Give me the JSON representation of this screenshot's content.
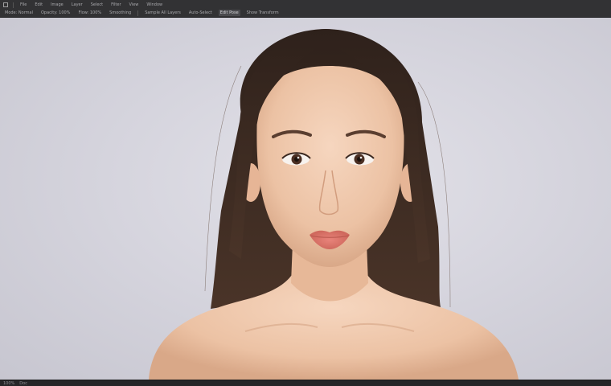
{
  "toolbar": {
    "row1": [
      {
        "icon": "app-menu-icon"
      },
      {
        "label": "File"
      },
      {
        "label": "Edit"
      },
      {
        "label": "Image"
      },
      {
        "label": "Layer"
      },
      {
        "label": "Select"
      },
      {
        "label": "Filter"
      },
      {
        "label": "View"
      },
      {
        "label": "Window"
      }
    ],
    "row2": [
      {
        "label": "Mode: Normal"
      },
      {
        "label": "Opacity: 100%"
      },
      {
        "label": "Flow: 100%"
      },
      {
        "label": "Smoothing"
      },
      {
        "label": "Sample All Layers"
      },
      {
        "label": "Auto-Select"
      },
      {
        "label": "Edit Pose",
        "active": true
      },
      {
        "label": "Show Transform"
      }
    ]
  },
  "status": {
    "zoom": "100%",
    "info": "Doc"
  },
  "colors": {
    "background": "#d6d5de",
    "hair": "#3a2a22",
    "skin": "#f0c9ad",
    "lips": "#e07a6a"
  }
}
